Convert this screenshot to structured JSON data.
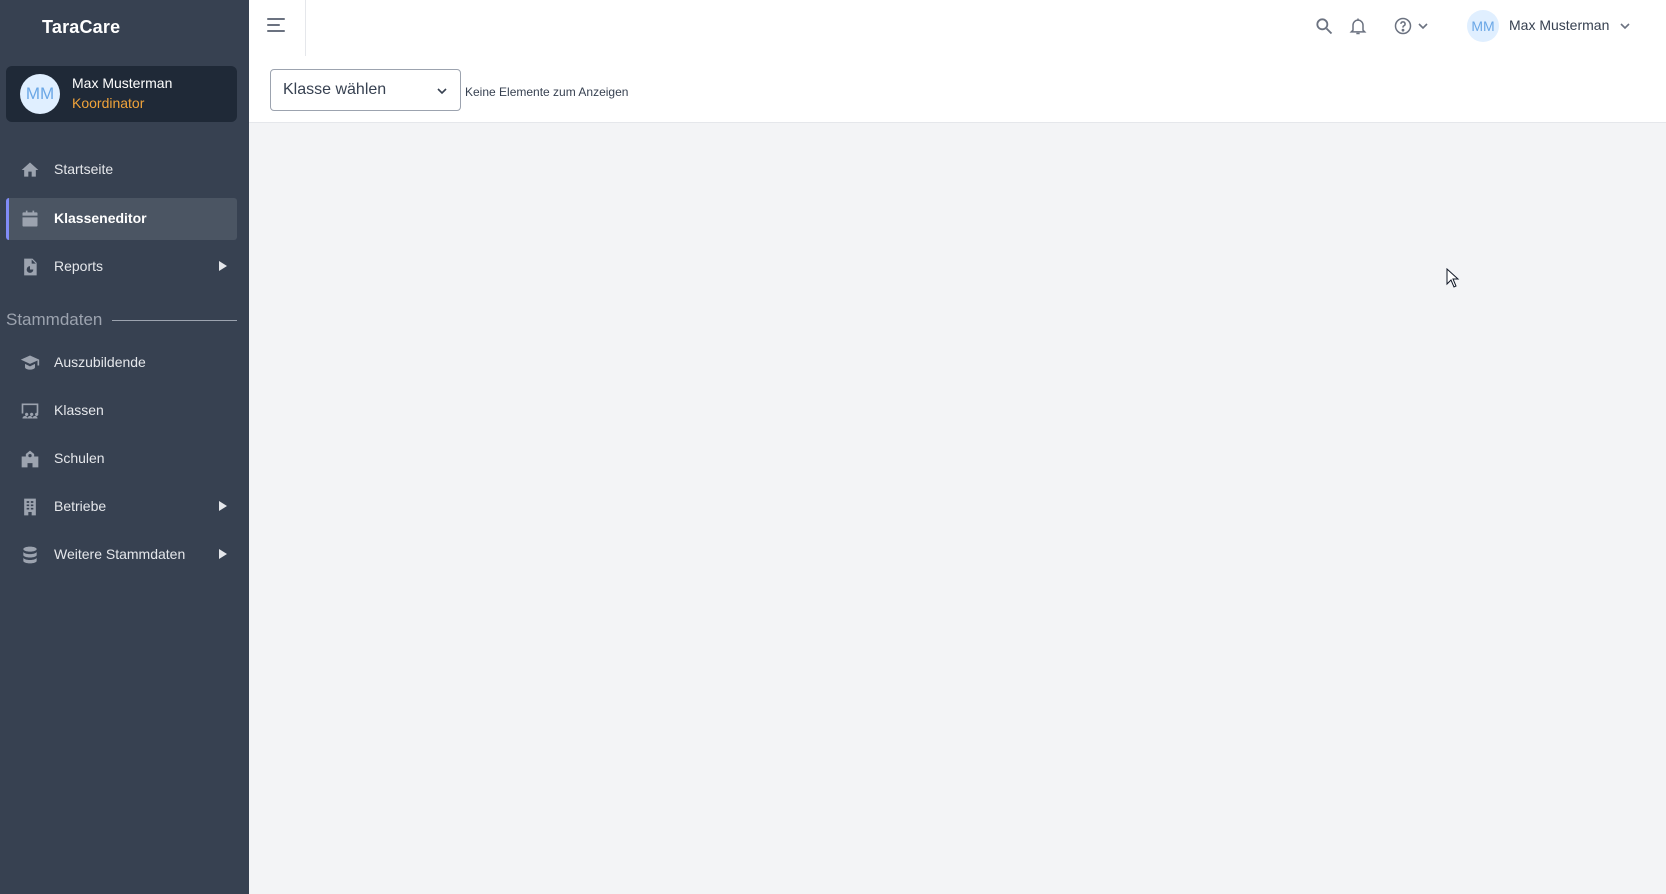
{
  "brand": "TaraCare",
  "user": {
    "initials": "MM",
    "name": "Max Musterman",
    "role": "Koordinator"
  },
  "nav": {
    "startseite": "Startseite",
    "klasseneditor": "Klasseneditor",
    "reports": "Reports",
    "section_stammdaten": "Stammdaten",
    "auszubildende": "Auszubildende",
    "klassen": "Klassen",
    "schulen": "Schulen",
    "betriebe": "Betriebe",
    "weitere": "Weitere Stammdaten"
  },
  "topbar": {
    "user_initials": "MM",
    "user_name": "Max Musterman"
  },
  "toolbar": {
    "select_value": "Klasse wählen",
    "empty_message": "Keine Elemente zum Anzeigen"
  },
  "colors": {
    "sidebar_bg": "#374151",
    "user_card_bg": "#1f2937",
    "active_bg": "#4b5563",
    "active_accent": "#818cf8",
    "role_color": "#f0a33a",
    "content_bg": "#f3f4f6"
  },
  "icons": [
    "home-icon",
    "calendar-icon",
    "report-icon",
    "graduate-icon",
    "classroom-icon",
    "school-icon",
    "building-icon",
    "database-icon",
    "menu-icon",
    "search-icon",
    "bell-icon",
    "help-icon",
    "chevron-down-icon"
  ]
}
